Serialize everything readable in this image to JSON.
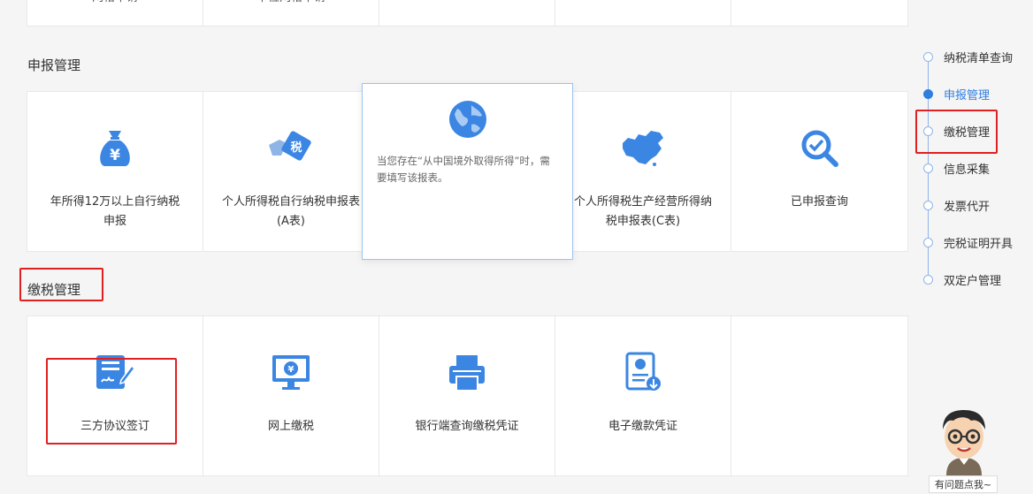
{
  "top_row": {
    "items": [
      {
        "label": "网格申请"
      },
      {
        "label": "单位网格申请"
      },
      {
        "label": ""
      },
      {
        "label": ""
      },
      {
        "label": ""
      }
    ]
  },
  "declaration": {
    "title": "申报管理",
    "items": [
      {
        "label": "年所得12万以上自行纳税申报",
        "icon": "money-bag-icon"
      },
      {
        "label": "个人所得税自行纳税申报表(A表)",
        "icon": "tax-hand-icon"
      },
      {
        "label": "",
        "icon": "globe-icon"
      },
      {
        "label": "个人所得税生产经营所得纳税申报表(C表)",
        "icon": "china-map-icon"
      },
      {
        "label": "已申报查询",
        "icon": "search-check-icon"
      }
    ],
    "popup_text": "当您存在“从中国境外取得所得”时，需要填写该报表。"
  },
  "payment": {
    "title": "缴税管理",
    "items": [
      {
        "label": "三方协议签订",
        "icon": "contract-sign-icon"
      },
      {
        "label": "网上缴税",
        "icon": "monitor-yen-icon"
      },
      {
        "label": "银行端查询缴税凭证",
        "icon": "printer-icon"
      },
      {
        "label": "电子缴款凭证",
        "icon": "e-certificate-icon"
      },
      {
        "label": "",
        "icon": ""
      }
    ]
  },
  "side_nav": {
    "items": [
      {
        "label": "纳税清单查询",
        "active": false
      },
      {
        "label": "申报管理",
        "active": true
      },
      {
        "label": "缴税管理",
        "active": false
      },
      {
        "label": "信息采集",
        "active": false
      },
      {
        "label": "发票代开",
        "active": false
      },
      {
        "label": "完税证明开具",
        "active": false
      },
      {
        "label": "双定户管理",
        "active": false
      }
    ]
  },
  "assistant": {
    "label": "有问题点我~"
  },
  "colors": {
    "accent": "#2f7ee0",
    "icon_blue": "#3b86e3",
    "highlight_red": "#e02020"
  }
}
